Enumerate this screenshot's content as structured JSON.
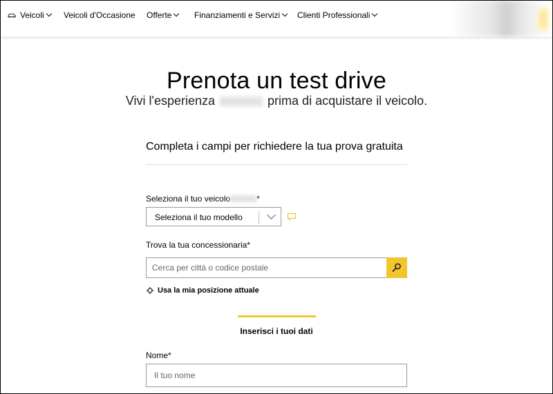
{
  "nav": {
    "items": [
      {
        "label": "Veicoli",
        "has_dropdown": true,
        "icon": "car-icon"
      },
      {
        "label": "Veicoli d'Occasione",
        "has_dropdown": false
      },
      {
        "label": "Offerte",
        "has_dropdown": true
      },
      {
        "label": "Finanziamenti e Servizi",
        "has_dropdown": true
      },
      {
        "label": "Clienti Professionali",
        "has_dropdown": true
      }
    ]
  },
  "page": {
    "title": "Prenota un test drive",
    "subtitle_before": "Vivi l'esperienza",
    "subtitle_after": "prima di acquistare il veicolo."
  },
  "form": {
    "intro": "Completa i campi per richiedere la tua prova gratuita",
    "vehicle_label": "Seleziona il tuo veicolo",
    "vehicle_required": "*",
    "vehicle_select_value": "Seleziona il tuo modello",
    "dealer_label": "Trova la tua concessionaria*",
    "dealer_placeholder": "Cerca per città o codice postale",
    "use_location": "Usa la mia posizione attuale",
    "personal_heading": "Inserisci i tuoi dati",
    "name_label": "Nome*",
    "name_placeholder": "Il tuo nome"
  },
  "colors": {
    "accent": "#f2c530",
    "border": "#999999",
    "divider": "#dddddd"
  }
}
